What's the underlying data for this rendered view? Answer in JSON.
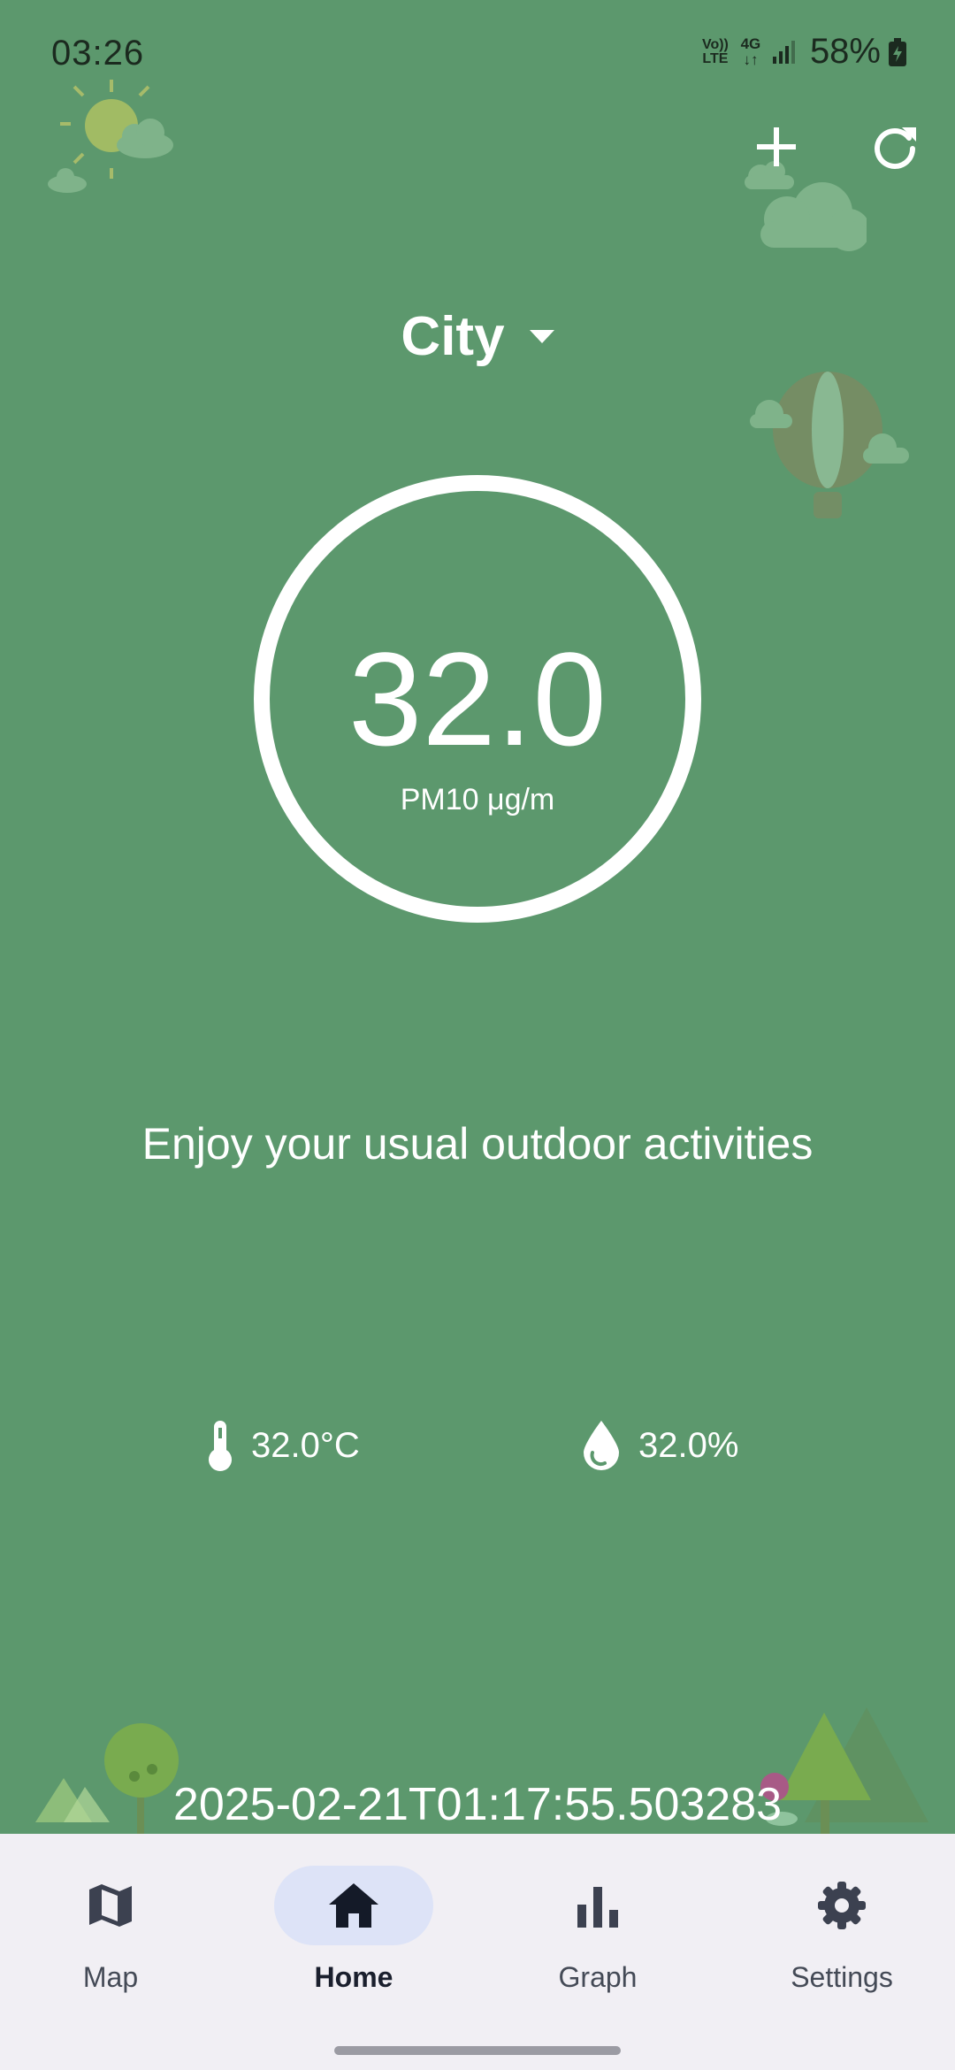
{
  "status_bar": {
    "time": "03:26",
    "network_top": "Vo))",
    "network_bottom": "LTE",
    "network_type": "4G",
    "battery": "58%"
  },
  "header": {
    "add_icon": "plus-icon",
    "refresh_icon": "refresh-icon"
  },
  "location": {
    "selected": "City",
    "dropdown_icon": "caret-down-icon"
  },
  "reading": {
    "value": "32.0",
    "unit": "PM10 μg/m"
  },
  "advice": "Enjoy your usual outdoor activities",
  "conditions": {
    "temperature": "32.0°C",
    "humidity": "32.0%"
  },
  "timestamp": "2025-02-21T01:17:55.503283",
  "nav": {
    "items": [
      {
        "label": "Map",
        "icon": "map-icon"
      },
      {
        "label": "Home",
        "icon": "home-icon",
        "active": true
      },
      {
        "label": "Graph",
        "icon": "bar-chart-icon"
      },
      {
        "label": "Settings",
        "icon": "gear-icon"
      }
    ]
  },
  "colors": {
    "background": "#5c986d",
    "nav_background": "#f1eff4",
    "active_pill": "#dde3f7",
    "text_light": "#ffffff"
  }
}
